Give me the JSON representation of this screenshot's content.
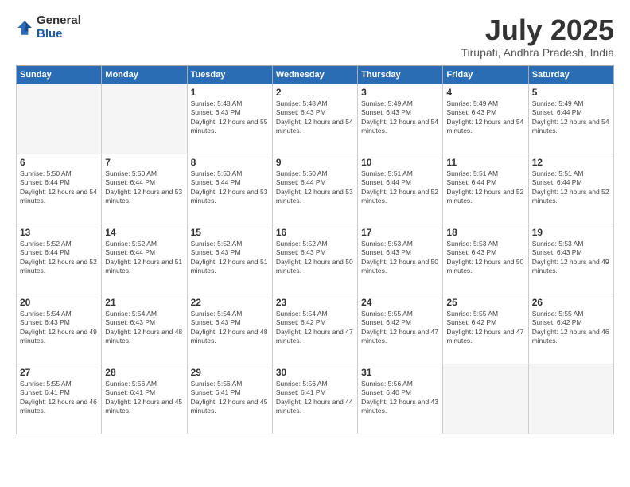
{
  "logo": {
    "general": "General",
    "blue": "Blue"
  },
  "title": "July 2025",
  "subtitle": "Tirupati, Andhra Pradesh, India",
  "headers": [
    "Sunday",
    "Monday",
    "Tuesday",
    "Wednesday",
    "Thursday",
    "Friday",
    "Saturday"
  ],
  "weeks": [
    [
      {
        "day": "",
        "info": ""
      },
      {
        "day": "",
        "info": ""
      },
      {
        "day": "1",
        "info": "Sunrise: 5:48 AM\nSunset: 6:43 PM\nDaylight: 12 hours and 55 minutes."
      },
      {
        "day": "2",
        "info": "Sunrise: 5:48 AM\nSunset: 6:43 PM\nDaylight: 12 hours and 54 minutes."
      },
      {
        "day": "3",
        "info": "Sunrise: 5:49 AM\nSunset: 6:43 PM\nDaylight: 12 hours and 54 minutes."
      },
      {
        "day": "4",
        "info": "Sunrise: 5:49 AM\nSunset: 6:43 PM\nDaylight: 12 hours and 54 minutes."
      },
      {
        "day": "5",
        "info": "Sunrise: 5:49 AM\nSunset: 6:44 PM\nDaylight: 12 hours and 54 minutes."
      }
    ],
    [
      {
        "day": "6",
        "info": "Sunrise: 5:50 AM\nSunset: 6:44 PM\nDaylight: 12 hours and 54 minutes."
      },
      {
        "day": "7",
        "info": "Sunrise: 5:50 AM\nSunset: 6:44 PM\nDaylight: 12 hours and 53 minutes."
      },
      {
        "day": "8",
        "info": "Sunrise: 5:50 AM\nSunset: 6:44 PM\nDaylight: 12 hours and 53 minutes."
      },
      {
        "day": "9",
        "info": "Sunrise: 5:50 AM\nSunset: 6:44 PM\nDaylight: 12 hours and 53 minutes."
      },
      {
        "day": "10",
        "info": "Sunrise: 5:51 AM\nSunset: 6:44 PM\nDaylight: 12 hours and 52 minutes."
      },
      {
        "day": "11",
        "info": "Sunrise: 5:51 AM\nSunset: 6:44 PM\nDaylight: 12 hours and 52 minutes."
      },
      {
        "day": "12",
        "info": "Sunrise: 5:51 AM\nSunset: 6:44 PM\nDaylight: 12 hours and 52 minutes."
      }
    ],
    [
      {
        "day": "13",
        "info": "Sunrise: 5:52 AM\nSunset: 6:44 PM\nDaylight: 12 hours and 52 minutes."
      },
      {
        "day": "14",
        "info": "Sunrise: 5:52 AM\nSunset: 6:44 PM\nDaylight: 12 hours and 51 minutes."
      },
      {
        "day": "15",
        "info": "Sunrise: 5:52 AM\nSunset: 6:43 PM\nDaylight: 12 hours and 51 minutes."
      },
      {
        "day": "16",
        "info": "Sunrise: 5:52 AM\nSunset: 6:43 PM\nDaylight: 12 hours and 50 minutes."
      },
      {
        "day": "17",
        "info": "Sunrise: 5:53 AM\nSunset: 6:43 PM\nDaylight: 12 hours and 50 minutes."
      },
      {
        "day": "18",
        "info": "Sunrise: 5:53 AM\nSunset: 6:43 PM\nDaylight: 12 hours and 50 minutes."
      },
      {
        "day": "19",
        "info": "Sunrise: 5:53 AM\nSunset: 6:43 PM\nDaylight: 12 hours and 49 minutes."
      }
    ],
    [
      {
        "day": "20",
        "info": "Sunrise: 5:54 AM\nSunset: 6:43 PM\nDaylight: 12 hours and 49 minutes."
      },
      {
        "day": "21",
        "info": "Sunrise: 5:54 AM\nSunset: 6:43 PM\nDaylight: 12 hours and 48 minutes."
      },
      {
        "day": "22",
        "info": "Sunrise: 5:54 AM\nSunset: 6:43 PM\nDaylight: 12 hours and 48 minutes."
      },
      {
        "day": "23",
        "info": "Sunrise: 5:54 AM\nSunset: 6:42 PM\nDaylight: 12 hours and 47 minutes."
      },
      {
        "day": "24",
        "info": "Sunrise: 5:55 AM\nSunset: 6:42 PM\nDaylight: 12 hours and 47 minutes."
      },
      {
        "day": "25",
        "info": "Sunrise: 5:55 AM\nSunset: 6:42 PM\nDaylight: 12 hours and 47 minutes."
      },
      {
        "day": "26",
        "info": "Sunrise: 5:55 AM\nSunset: 6:42 PM\nDaylight: 12 hours and 46 minutes."
      }
    ],
    [
      {
        "day": "27",
        "info": "Sunrise: 5:55 AM\nSunset: 6:41 PM\nDaylight: 12 hours and 46 minutes."
      },
      {
        "day": "28",
        "info": "Sunrise: 5:56 AM\nSunset: 6:41 PM\nDaylight: 12 hours and 45 minutes."
      },
      {
        "day": "29",
        "info": "Sunrise: 5:56 AM\nSunset: 6:41 PM\nDaylight: 12 hours and 45 minutes."
      },
      {
        "day": "30",
        "info": "Sunrise: 5:56 AM\nSunset: 6:41 PM\nDaylight: 12 hours and 44 minutes."
      },
      {
        "day": "31",
        "info": "Sunrise: 5:56 AM\nSunset: 6:40 PM\nDaylight: 12 hours and 43 minutes."
      },
      {
        "day": "",
        "info": ""
      },
      {
        "day": "",
        "info": ""
      }
    ]
  ]
}
